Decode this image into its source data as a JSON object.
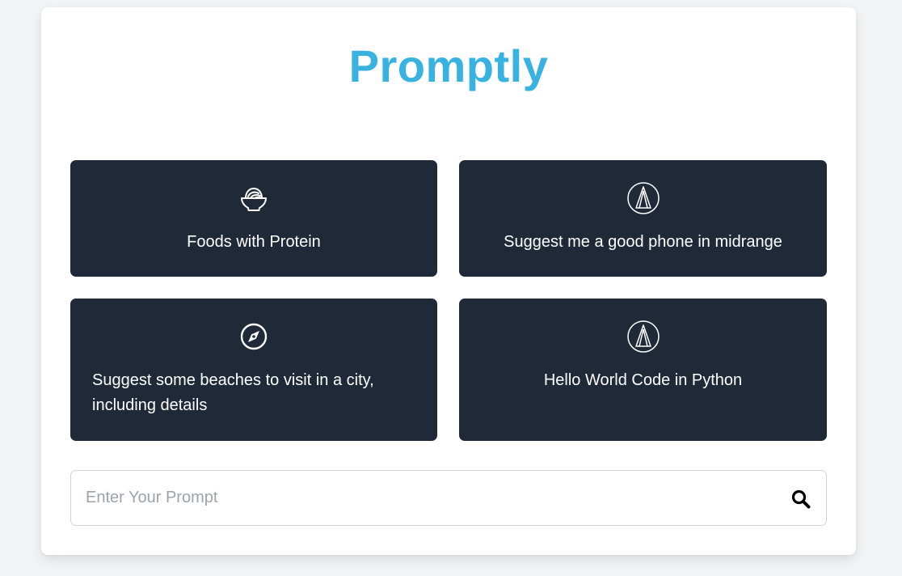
{
  "app": {
    "title": "Promptly"
  },
  "suggestions": [
    {
      "label": "Foods with Protein",
      "icon": "bowl-icon"
    },
    {
      "label": "Suggest me a good phone in midrange",
      "icon": "pen-nib-icon"
    },
    {
      "label": "Suggest some beaches to visit in a city, including details",
      "icon": "compass-icon"
    },
    {
      "label": "Hello World Code in Python",
      "icon": "pen-nib-icon"
    }
  ],
  "prompt": {
    "value": "",
    "placeholder": "Enter Your Prompt",
    "submit_icon": "search-icon"
  },
  "colors": {
    "brand": "#38b2e0",
    "tile_background": "#1f2937",
    "page_background": "#f3f4f6"
  }
}
